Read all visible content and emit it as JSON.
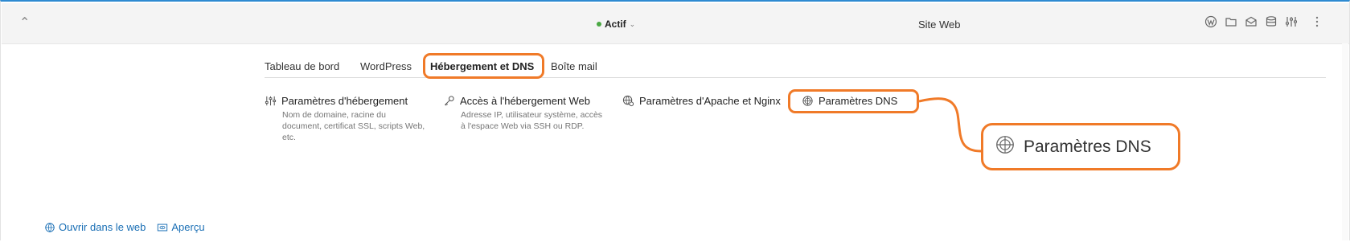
{
  "header": {
    "status": {
      "label": "Actif",
      "dot_color": "#4aa843"
    },
    "site_title": "Site Web",
    "icons": [
      "wordpress-icon",
      "folder-icon",
      "mail-icon",
      "database-icon",
      "settings-sliders-icon",
      "more-options-icon"
    ]
  },
  "tabs": [
    {
      "label": "Tableau de bord"
    },
    {
      "label": "WordPress"
    },
    {
      "label": "Hébergement et DNS",
      "active": true
    },
    {
      "label": "Boîte mail"
    }
  ],
  "settings": [
    {
      "title": "Paramètres d'hébergement",
      "desc_lines": [
        "Nom de domaine, racine du",
        "document, certificat SSL, scripts Web,",
        "etc."
      ],
      "icon": "sliders-icon"
    },
    {
      "title": "Accès à l'hébergement Web",
      "desc_lines": [
        "Adresse IP, utilisateur système, accès",
        "à l'espace Web via SSH ou RDP."
      ],
      "icon": "key-icon"
    },
    {
      "title": "Paramètres d'Apache et Nginx",
      "desc_lines": [],
      "icon": "globe-gear-icon"
    },
    {
      "title": "Paramètres DNS",
      "desc_lines": [],
      "icon": "dns-globe-icon"
    }
  ],
  "callout": {
    "label": "Paramètres DNS"
  },
  "footer": {
    "open_web": "Ouvrir dans le web",
    "preview": "Aperçu"
  },
  "colors": {
    "accent_highlight": "#f07a28",
    "link": "#1a6fb5",
    "top_border": "#2e8ad1"
  }
}
